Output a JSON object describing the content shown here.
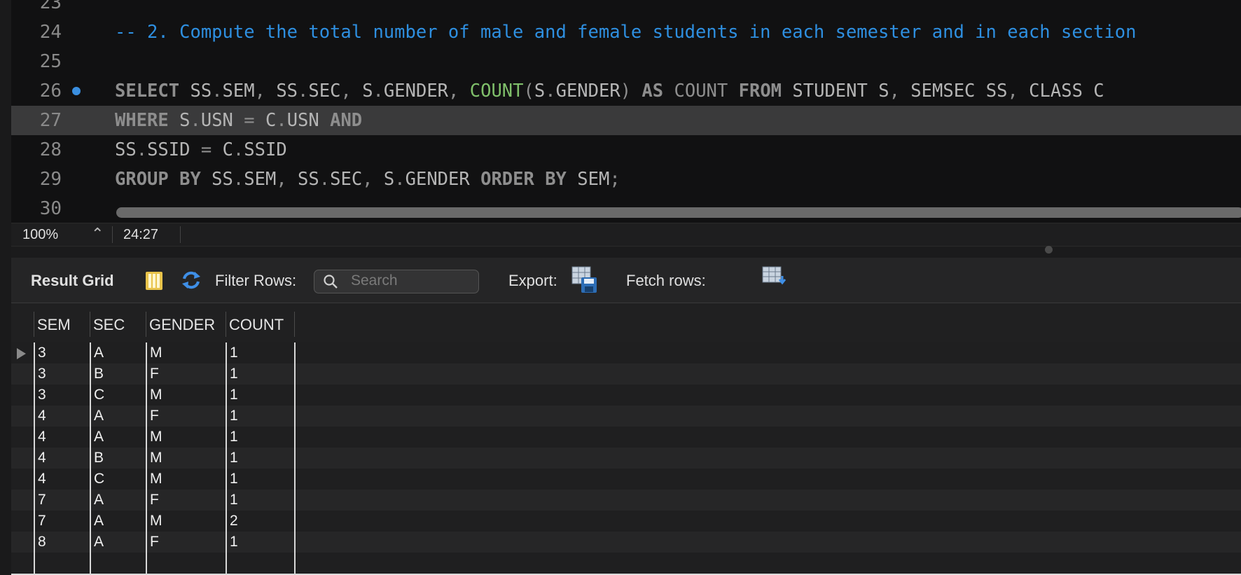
{
  "editor": {
    "lines": [
      {
        "num": "23",
        "tokens": [
          {
            "t": "",
            "c": "p"
          }
        ]
      },
      {
        "num": "24",
        "tokens": [
          {
            "t": "-- 2. Compute the total number of male and female students in each semester and in each section",
            "c": "c"
          }
        ]
      },
      {
        "num": "25",
        "tokens": [
          {
            "t": "",
            "c": "p"
          }
        ]
      },
      {
        "num": "26",
        "tokens": [
          {
            "t": "SELECT",
            "c": "k"
          },
          {
            "t": " SS",
            "c": "p"
          },
          {
            "t": ".",
            "c": "d"
          },
          {
            "t": "SEM",
            "c": "p"
          },
          {
            "t": ", ",
            "c": "d"
          },
          {
            "t": "SS",
            "c": "p"
          },
          {
            "t": ".",
            "c": "d"
          },
          {
            "t": "SEC",
            "c": "p"
          },
          {
            "t": ", ",
            "c": "d"
          },
          {
            "t": "S",
            "c": "p"
          },
          {
            "t": ".",
            "c": "d"
          },
          {
            "t": "GENDER",
            "c": "p"
          },
          {
            "t": ", ",
            "c": "d"
          },
          {
            "t": "COUNT",
            "c": "f"
          },
          {
            "t": "(",
            "c": "d"
          },
          {
            "t": "S",
            "c": "p"
          },
          {
            "t": ".",
            "c": "d"
          },
          {
            "t": "GENDER",
            "c": "p"
          },
          {
            "t": ")",
            "c": "d"
          },
          {
            "t": " AS",
            "c": "k"
          },
          {
            "t": " COUNT",
            "c": "d"
          },
          {
            "t": " FROM",
            "c": "k"
          },
          {
            "t": " STUDENT S",
            "c": "p"
          },
          {
            "t": ", ",
            "c": "d"
          },
          {
            "t": "SEMSEC SS",
            "c": "p"
          },
          {
            "t": ", ",
            "c": "d"
          },
          {
            "t": "CLASS C",
            "c": "p"
          }
        ]
      },
      {
        "num": "27",
        "tokens": [
          {
            "t": "WHERE",
            "c": "k"
          },
          {
            "t": " S",
            "c": "p"
          },
          {
            "t": ".",
            "c": "d"
          },
          {
            "t": "USN",
            "c": "p"
          },
          {
            "t": " = ",
            "c": "d"
          },
          {
            "t": "C",
            "c": "p"
          },
          {
            "t": ".",
            "c": "d"
          },
          {
            "t": "USN",
            "c": "p"
          },
          {
            "t": " AND",
            "c": "k"
          }
        ]
      },
      {
        "num": "28",
        "tokens": [
          {
            "t": "SS",
            "c": "p"
          },
          {
            "t": ".",
            "c": "d"
          },
          {
            "t": "SSID",
            "c": "p"
          },
          {
            "t": " = ",
            "c": "d"
          },
          {
            "t": "C",
            "c": "p"
          },
          {
            "t": ".",
            "c": "d"
          },
          {
            "t": "SSID",
            "c": "p"
          }
        ]
      },
      {
        "num": "29",
        "tokens": [
          {
            "t": "GROUP BY",
            "c": "k"
          },
          {
            "t": " SS",
            "c": "p"
          },
          {
            "t": ".",
            "c": "d"
          },
          {
            "t": "SEM",
            "c": "p"
          },
          {
            "t": ", ",
            "c": "d"
          },
          {
            "t": "SS",
            "c": "p"
          },
          {
            "t": ".",
            "c": "d"
          },
          {
            "t": "SEC",
            "c": "p"
          },
          {
            "t": ", ",
            "c": "d"
          },
          {
            "t": "S",
            "c": "p"
          },
          {
            "t": ".",
            "c": "d"
          },
          {
            "t": "GENDER",
            "c": "p"
          },
          {
            "t": " ORDER BY",
            "c": "k"
          },
          {
            "t": " SEM",
            "c": "p"
          },
          {
            "t": ";",
            "c": "d"
          }
        ]
      },
      {
        "num": "30",
        "tokens": [
          {
            "t": "",
            "c": "p"
          }
        ]
      }
    ],
    "highlighted_line": "27",
    "breakpoint_line": "26",
    "colors": {
      "comment": "#2e8fe0",
      "keyword": "#8e8e8e",
      "function": "#7fbf6a",
      "breakpoint": "#3a8fe0"
    }
  },
  "status": {
    "zoom": "100%",
    "cursor": "24:27"
  },
  "toolbar": {
    "result_grid_label": "Result Grid",
    "filter_label": "Filter Rows:",
    "search_placeholder": "Search",
    "export_label": "Export:",
    "fetch_label": "Fetch rows:",
    "icons": [
      "grid-layout-icon",
      "refresh-icon",
      "search-icon",
      "export-icon",
      "fetch-rows-icon"
    ]
  },
  "grid": {
    "columns": [
      "SEM",
      "SEC",
      "GENDER",
      "COUNT"
    ],
    "rows": [
      [
        "3",
        "A",
        "M",
        "1"
      ],
      [
        "3",
        "B",
        "F",
        "1"
      ],
      [
        "3",
        "C",
        "M",
        "1"
      ],
      [
        "4",
        "A",
        "F",
        "1"
      ],
      [
        "4",
        "A",
        "M",
        "1"
      ],
      [
        "4",
        "B",
        "M",
        "1"
      ],
      [
        "4",
        "C",
        "M",
        "1"
      ],
      [
        "7",
        "A",
        "F",
        "1"
      ],
      [
        "7",
        "A",
        "M",
        "2"
      ],
      [
        "8",
        "A",
        "F",
        "1"
      ]
    ]
  }
}
